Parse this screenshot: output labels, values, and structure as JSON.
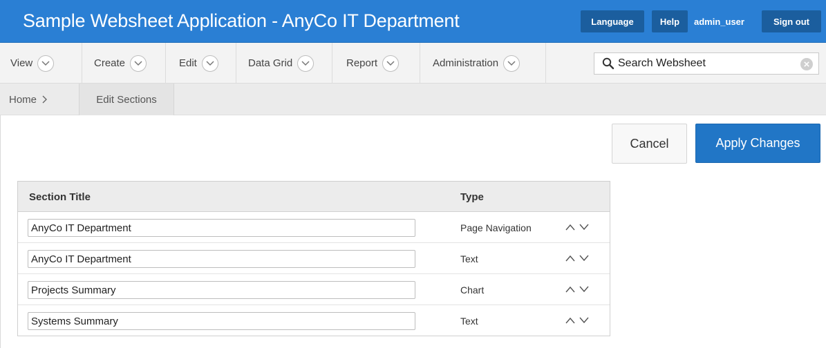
{
  "header": {
    "title": "Sample Websheet Application - AnyCo IT Department",
    "language_label": "Language",
    "help_label": "Help",
    "username": "admin_user",
    "signout_label": "Sign out"
  },
  "menu": {
    "items": [
      {
        "label": "View",
        "icon": "chevron-down-icon"
      },
      {
        "label": "Create",
        "icon": "chevron-down-icon"
      },
      {
        "label": "Edit",
        "icon": "chevron-down-icon"
      },
      {
        "label": "Data Grid",
        "icon": "chevron-down-icon"
      },
      {
        "label": "Report",
        "icon": "chevron-down-icon"
      },
      {
        "label": "Administration",
        "icon": "chevron-down-icon"
      }
    ]
  },
  "search": {
    "placeholder": "Search Websheet",
    "icon": "search-icon"
  },
  "breadcrumb": {
    "home": "Home",
    "current": "Edit Sections"
  },
  "actions": {
    "cancel_label": "Cancel",
    "apply_label": "Apply Changes"
  },
  "table": {
    "columns": [
      "Section Title",
      "Type"
    ],
    "rows": [
      {
        "title": "AnyCo IT Department",
        "type": "Page Navigation"
      },
      {
        "title": "AnyCo IT Department",
        "type": "Text"
      },
      {
        "title": "Projects Summary",
        "type": "Chart"
      },
      {
        "title": "Systems Summary",
        "type": "Text"
      }
    ]
  },
  "colors": {
    "header_bg": "#2a7fd4",
    "header_button_bg": "#1b5e9e",
    "primary_button": "#2176c6",
    "menubar_bg": "#f3f3f3"
  }
}
